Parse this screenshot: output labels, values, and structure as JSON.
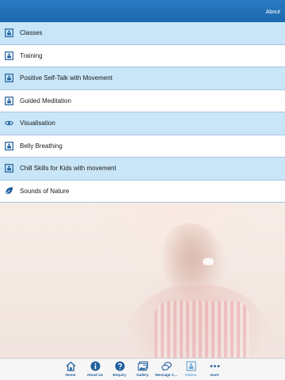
{
  "header": {
    "about_label": "About"
  },
  "menu": {
    "items": [
      {
        "label": "Classes",
        "icon": "video-icon",
        "style": "blue"
      },
      {
        "label": "Training",
        "icon": "video-icon",
        "style": "white"
      },
      {
        "label": "Positive Self-Talk with Movement",
        "icon": "video-icon",
        "style": "blue"
      },
      {
        "label": "Guided Meditation",
        "icon": "video-icon",
        "style": "white"
      },
      {
        "label": "Visualisation",
        "icon": "eye-icon",
        "style": "blue"
      },
      {
        "label": "Belly Breathing",
        "icon": "video-icon",
        "style": "white"
      },
      {
        "label": "Chill Skills for Kids with movement",
        "icon": "video-icon",
        "style": "blue"
      },
      {
        "label": "Sounds of Nature",
        "icon": "leaf-icon",
        "style": "white"
      }
    ]
  },
  "tabbar": {
    "tabs": [
      {
        "label": "Home",
        "icon": "home-icon"
      },
      {
        "label": "About Us",
        "icon": "info-icon"
      },
      {
        "label": "Enquiry",
        "icon": "question-icon"
      },
      {
        "label": "Gallery",
        "icon": "gallery-icon"
      },
      {
        "label": "Message C...",
        "icon": "message-icon"
      },
      {
        "label": "Videos",
        "icon": "videos-icon",
        "active": true
      },
      {
        "label": "more",
        "icon": "more-icon"
      }
    ]
  },
  "colors": {
    "header": "#1c68ad",
    "row_blue": "#c8e6f7",
    "row_white": "#ffffff",
    "icon_blue": "#1f5f9d",
    "tab_active": "#6aa6d8"
  }
}
